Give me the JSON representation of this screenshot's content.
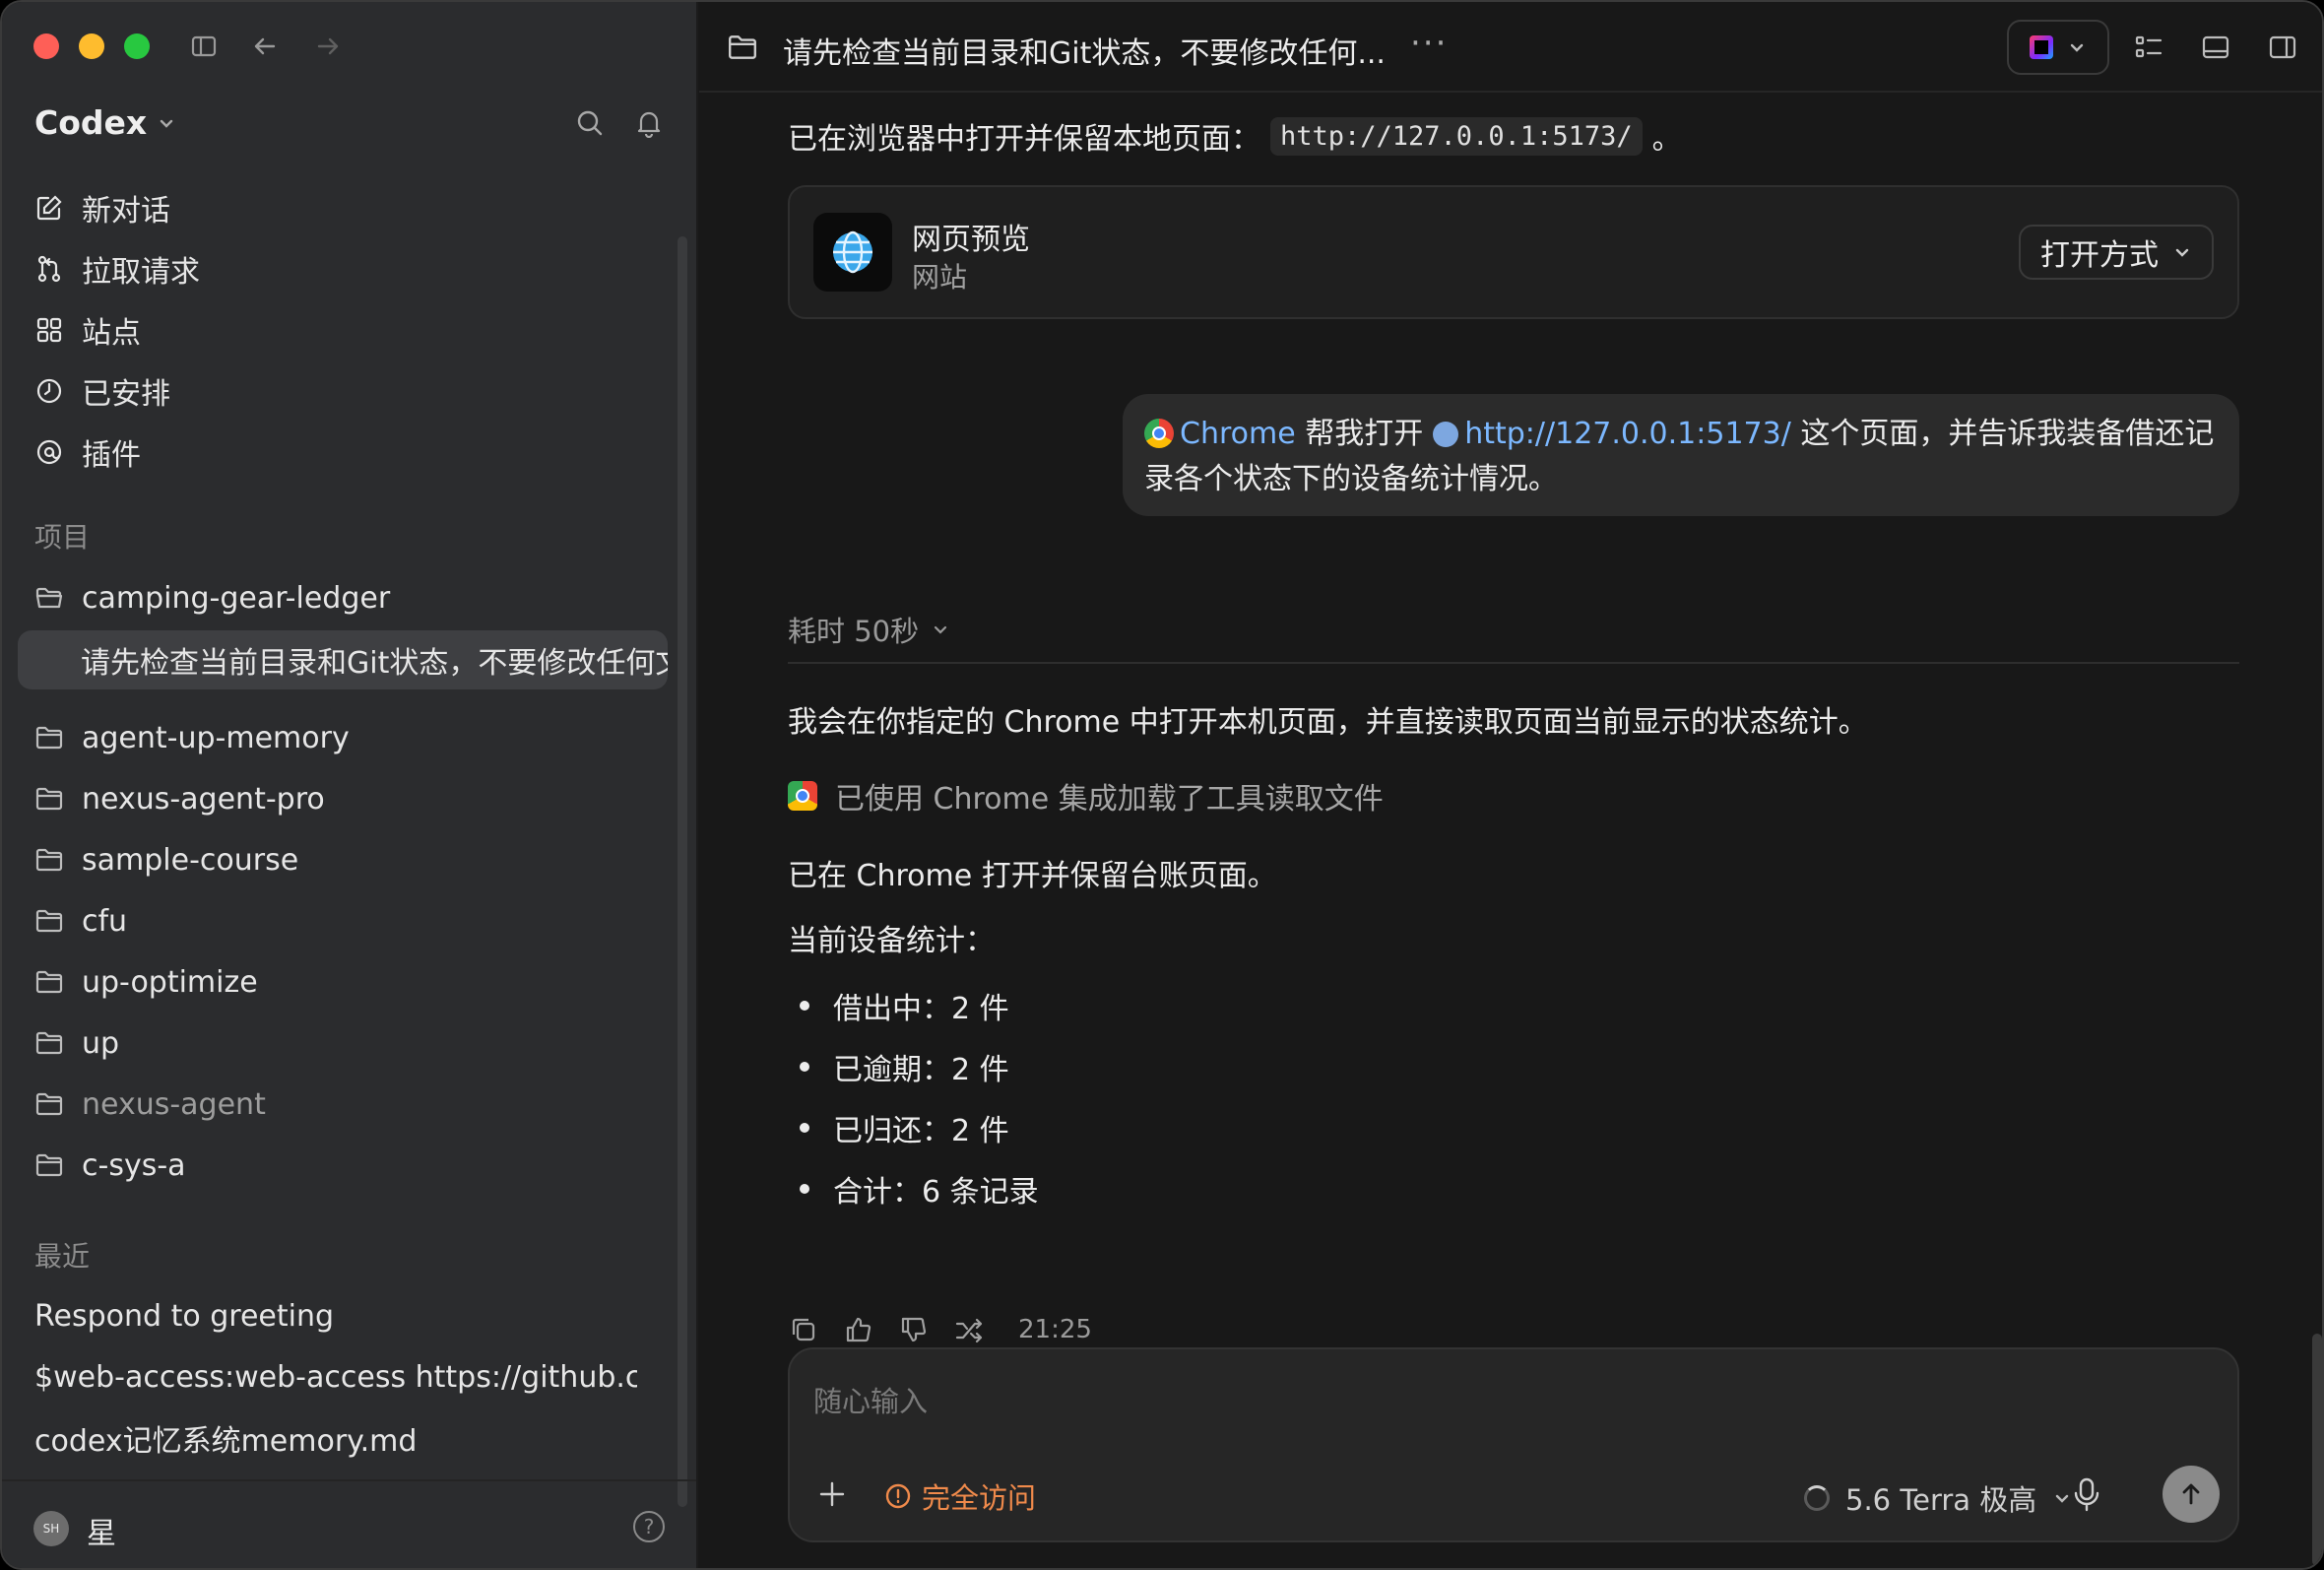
{
  "sidebar": {
    "brand": "Codex",
    "nav": [
      {
        "label": "新对话",
        "icon": "compose-icon"
      },
      {
        "label": "拉取请求",
        "icon": "pull-request-icon"
      },
      {
        "label": "站点",
        "icon": "grid-icon"
      },
      {
        "label": "已安排",
        "icon": "clock-icon"
      },
      {
        "label": "插件",
        "icon": "plugin-icon"
      }
    ],
    "projects_label": "项目",
    "projects": [
      {
        "label": "camping-gear-ledger"
      },
      {
        "label": "请先检查当前目录和Git状态，不要修改任何文件"
      },
      {
        "label": "agent-up-memory"
      },
      {
        "label": "nexus-agent-pro"
      },
      {
        "label": "sample-course"
      },
      {
        "label": "cfu"
      },
      {
        "label": "up-optimize"
      },
      {
        "label": "up"
      },
      {
        "label": "nexus-agent"
      },
      {
        "label": "c-sys-a"
      }
    ],
    "recent_label": "最近",
    "recent": [
      {
        "label": "Respond to greeting"
      },
      {
        "label": "$web-access:web-access https://github.com"
      },
      {
        "label": "codex记忆系统memory.md"
      }
    ],
    "user": {
      "initials": "SH",
      "name": "星"
    },
    "help": "?"
  },
  "topbar": {
    "title": "请先检查当前目录和Git状态，不要修改任何...",
    "more": "···"
  },
  "chat": {
    "intro_text": "已在浏览器中打开并保留本地页面：",
    "intro_url": "http://127.0.0.1:5173/",
    "intro_end": "。",
    "preview": {
      "title": "网页预览",
      "subtitle": "网站",
      "open_label": "打开方式"
    },
    "user_message": {
      "chip": "Chrome",
      "part1": "帮我打开",
      "link": "http://127.0.0.1:5173/",
      "part2": "这个页面，并告诉我装备借还记录各个状态下的设备统计情况。"
    },
    "elapsed": "耗时 50秒",
    "reply_1": "我会在你指定的 Chrome 中打开本机页面，并直接读取页面当前显示的状态统计。",
    "tool_used": "已使用 Chrome 集成加载了工具读取文件",
    "reply_2": "已在 Chrome 打开并保留台账页面。",
    "stats_heading": "当前设备统计：",
    "stats": [
      {
        "label": "借出中：2 件"
      },
      {
        "label": "已逾期：2 件"
      },
      {
        "label": "已归还：2 件"
      },
      {
        "label": "合计：6 条记录"
      }
    ],
    "time": "21:25"
  },
  "composer": {
    "placeholder": "随心输入",
    "access_label": "完全访问",
    "model_label": "5.6 Terra 极高"
  },
  "colors": {
    "accent_link": "#7cb8ff",
    "warning": "#f08a4b",
    "sidebar_bg": "#2b2c2e",
    "main_bg": "#181818"
  }
}
